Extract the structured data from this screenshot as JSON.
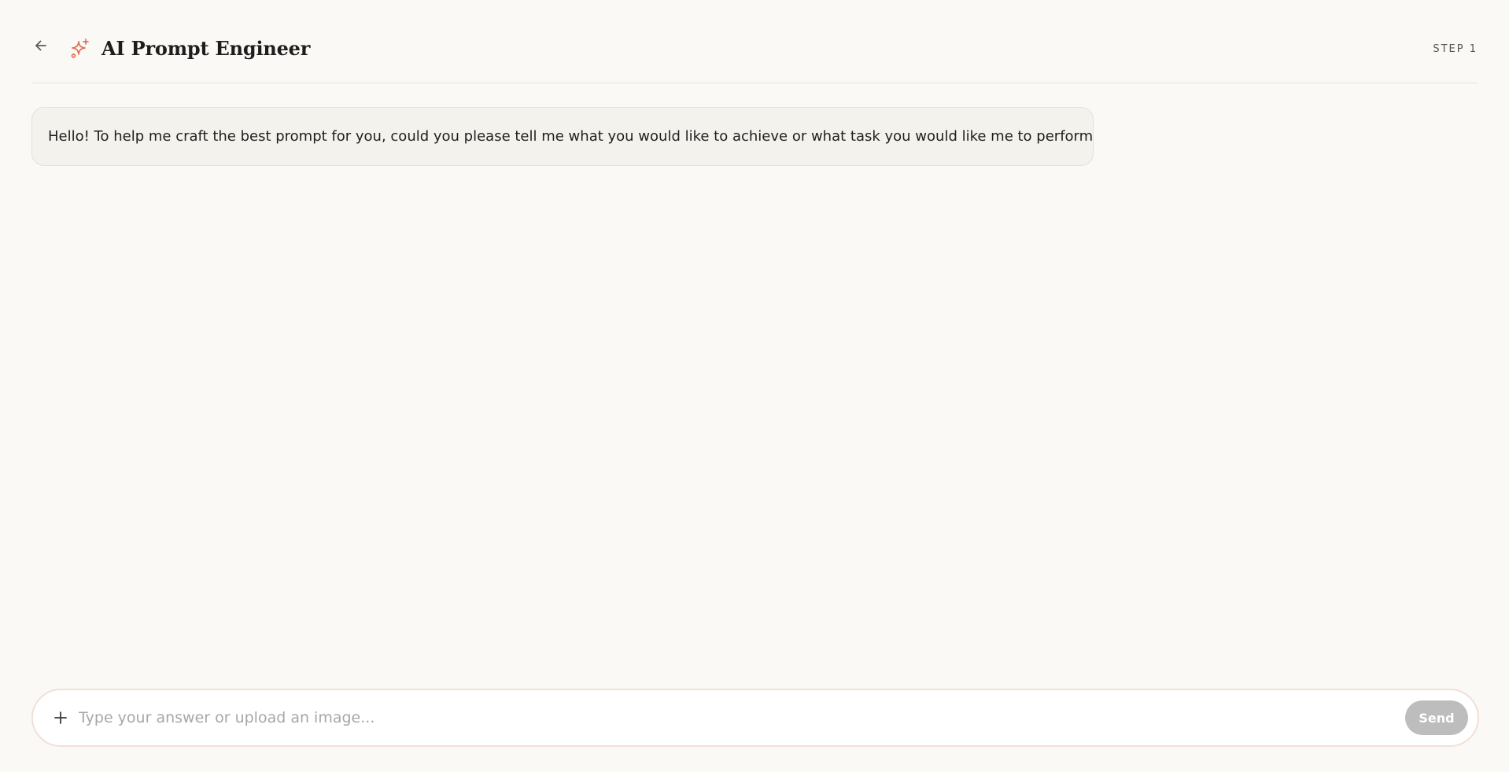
{
  "header": {
    "title": "AI Prompt Engineer",
    "step_label": "STEP 1",
    "back_icon": "arrow-left-icon",
    "logo_icon": "sparkles-icon"
  },
  "messages": [
    {
      "role": "assistant",
      "text": "Hello! To help me craft the best prompt for you, could you please tell me what you would like to achieve or what task you would like me to perform?"
    }
  ],
  "composer": {
    "placeholder": "Type your answer or upload an image...",
    "value": "",
    "attach_icon": "plus-icon",
    "send_label": "Send"
  },
  "colors": {
    "background": "#fbf9f5",
    "accent": "#e0705a",
    "bubble": "#f4f2ec",
    "send_disabled": "#bdbdbd"
  }
}
